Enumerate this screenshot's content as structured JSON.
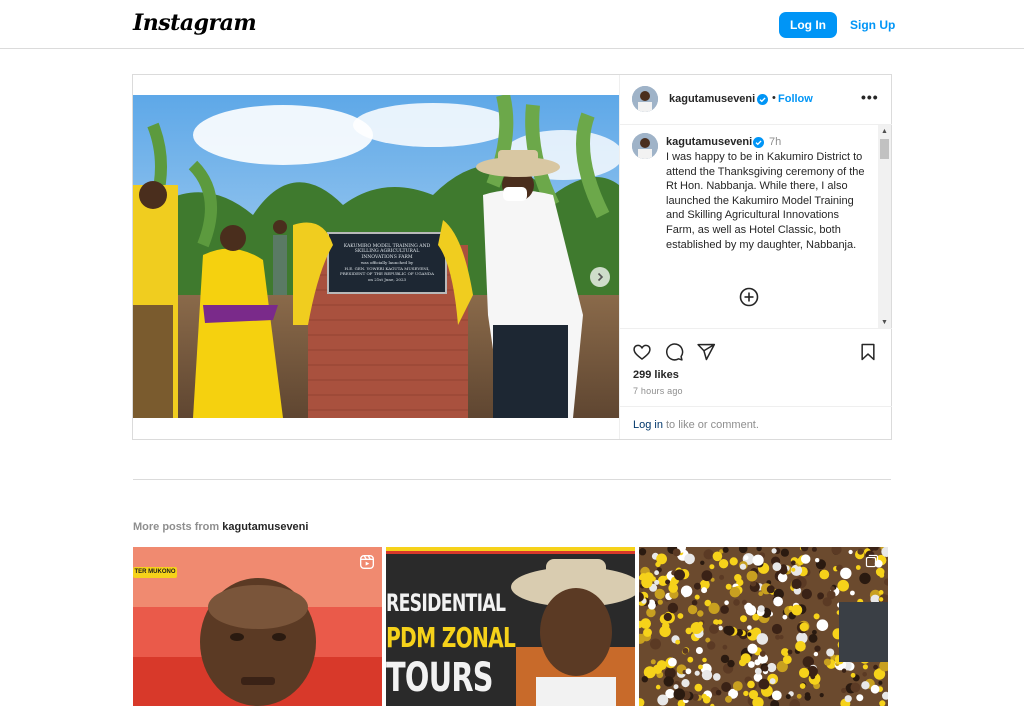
{
  "header": {
    "logo": "Instagram",
    "login_label": "Log In",
    "signup_label": "Sign Up"
  },
  "post": {
    "username": "kagutamuseveni",
    "separator": "•",
    "follow_label": "Follow",
    "more_label": "•••",
    "caption": {
      "username": "kagutamuseveni",
      "time": "7h",
      "text": "I was happy to be in Kakumiro District to attend the Thanksgiving ceremony of the Rt Hon. Nabbanja. While there, I also launched the Kakumiro Model Training and Skilling Agricultural Innovations Farm, as well as Hotel Classic, both established by my daughter, Nabbanja."
    },
    "plaque": {
      "line1": "KAKUMIRO MODEL TRAINING AND",
      "line2": "SKILLING AGRICULTURAL",
      "line3": "INNOVATIONS FARM",
      "line4": "was officially launched by",
      "line5": "H.E. GEN. YOWERI KAGUTA MUSEVENI,",
      "line6": "PRESIDENT OF THE REPUBLIC OF UGANDA",
      "line7": "on 21st June, 2023"
    },
    "likes": "299 likes",
    "time_ago": "7 hours ago",
    "login_link": "Log in",
    "login_rest": "to like or comment.",
    "carousel_dots": 4,
    "active_dot": 0
  },
  "more_posts": {
    "prefix": "More posts from",
    "username": "kagutamuseveni",
    "thumbs": [
      {
        "banner": "TER MUKONO",
        "icon": "reel-icon"
      },
      {
        "line1": "RESIDENTIAL",
        "line2": "PDM ZONAL",
        "line3": "TOURS"
      },
      {
        "icon": "carousel-icon"
      }
    ]
  },
  "colors": {
    "accent": "#0095f6",
    "border": "#dbdbdb",
    "muted": "#8e8e8e",
    "link_dark": "#00376b"
  }
}
